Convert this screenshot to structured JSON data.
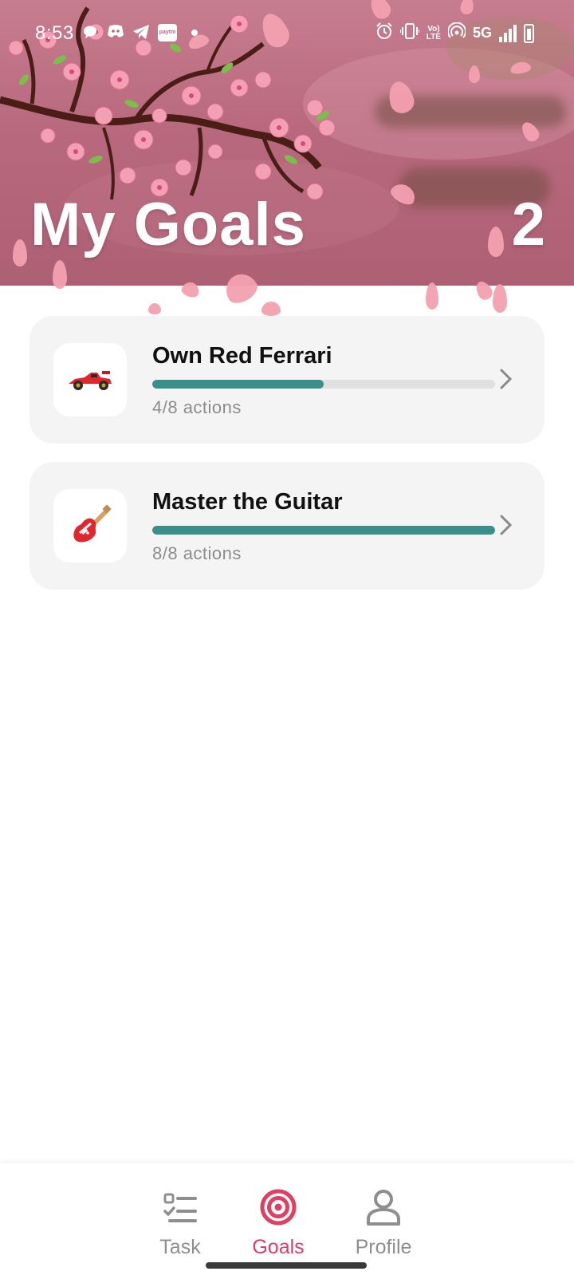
{
  "status_bar": {
    "time": "8:53",
    "network": "5G",
    "paytm_label": "paytm"
  },
  "header": {
    "title": "My Goals",
    "goal_count": "2"
  },
  "goals": [
    {
      "title": "Own Red Ferrari",
      "icon": "race-car-icon",
      "actions_text": "4/8 actions",
      "progress": 0.5
    },
    {
      "title": "Master the Guitar",
      "icon": "guitar-icon",
      "actions_text": "8/8 actions",
      "progress": 1.0
    }
  ],
  "bottom_nav": {
    "items": [
      {
        "label": "Task",
        "icon": "checklist-icon",
        "active": false
      },
      {
        "label": "Goals",
        "icon": "target-icon",
        "active": true
      },
      {
        "label": "Profile",
        "icon": "person-icon",
        "active": false
      }
    ]
  },
  "colors": {
    "accent": "#e23d63",
    "progress": "#3b8f8a",
    "inactive": "#8e8e8e"
  }
}
